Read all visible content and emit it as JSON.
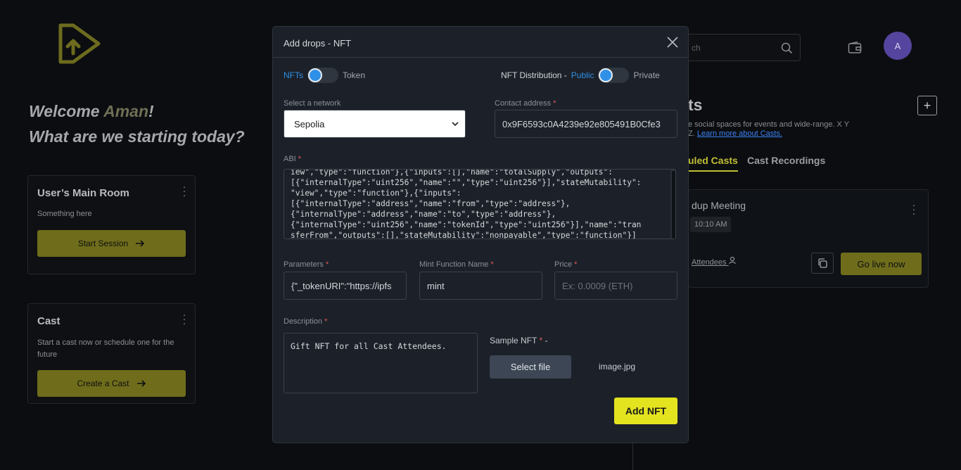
{
  "welcome": {
    "line1_prefix": "Welcome",
    "name": "Aman",
    "line1_suffix": "!",
    "line2": "What are we starting today?"
  },
  "rooms": [
    {
      "title": "User’s Main Room",
      "text": "Something here",
      "button": "Start Session"
    },
    {
      "title": "Cast",
      "text": "Start a cast now or schedule one for the future",
      "button": "Create a Cast"
    }
  ],
  "header": {
    "search_placeholder": "ch",
    "avatar_letter": "A"
  },
  "casts": {
    "heading": "ts",
    "description": "e social spaces for events and wide-range. X Y Z.",
    "link": "Learn more about Casts.",
    "tabs": [
      {
        "label": "uled Casts",
        "active": true
      },
      {
        "label": "Cast Recordings",
        "active": false
      }
    ],
    "meeting": {
      "title": "dup Meeting",
      "time": "10:10 AM",
      "attendees": "Attendees",
      "go_live": "Go live now"
    }
  },
  "modal": {
    "title": "Add drops - NFT",
    "toggle_left": {
      "on_label": "NFTs",
      "off_label": "Token"
    },
    "distribution": {
      "label": "NFT Distribution -",
      "on_label": "Public",
      "off_label": "Private"
    },
    "network": {
      "label": "Select a network",
      "value": "Sepolia"
    },
    "contract": {
      "label": "Contact address",
      "value": "0x9F6593c0A4239e92e805491B0Cfe3"
    },
    "abi": {
      "label": "ABI",
      "lines": [
        "iew\",\"type\":\"function\"},{\"inputs\":[],\"name\":\"totalSupply\",\"outputs\":",
        "[{\"internalType\":\"uint256\",\"name\":\"\",\"type\":\"uint256\"}],\"stateMutability\":",
        "\"view\",\"type\":\"function\"},{\"inputs\":",
        "[{\"internalType\":\"address\",\"name\":\"from\",\"type\":\"address\"},",
        "{\"internalType\":\"address\",\"name\":\"to\",\"type\":\"address\"},",
        "{\"internalType\":\"uint256\",\"name\":\"tokenId\",\"type\":\"uint256\"}],\"name\":\"tran",
        "sferFrom\",\"outputs\":[],\"stateMutability\":\"nonpayable\",\"type\":\"function\"}]"
      ]
    },
    "parameters": {
      "label": "Parameters",
      "value": "{\"_tokenURI\":\"https://ipfs"
    },
    "mint_function": {
      "label": "Mint Function Name",
      "value": "mint"
    },
    "price": {
      "label": "Price",
      "placeholder": "Ex: 0.0009 (ETH)"
    },
    "description": {
      "label": "Description",
      "value": "Gift NFT for all Cast Attendees."
    },
    "sample_nft": {
      "label": "Sample NFT",
      "suffix": " -",
      "button": "Select file",
      "file_name": "image.jpg"
    },
    "submit": "Add NFT"
  },
  "colors": {
    "accent_yellow": "#e4e31f",
    "accent_blue": "#2f90e8",
    "modal_bg": "#1c2129",
    "page_bg": "#0b0d10"
  }
}
